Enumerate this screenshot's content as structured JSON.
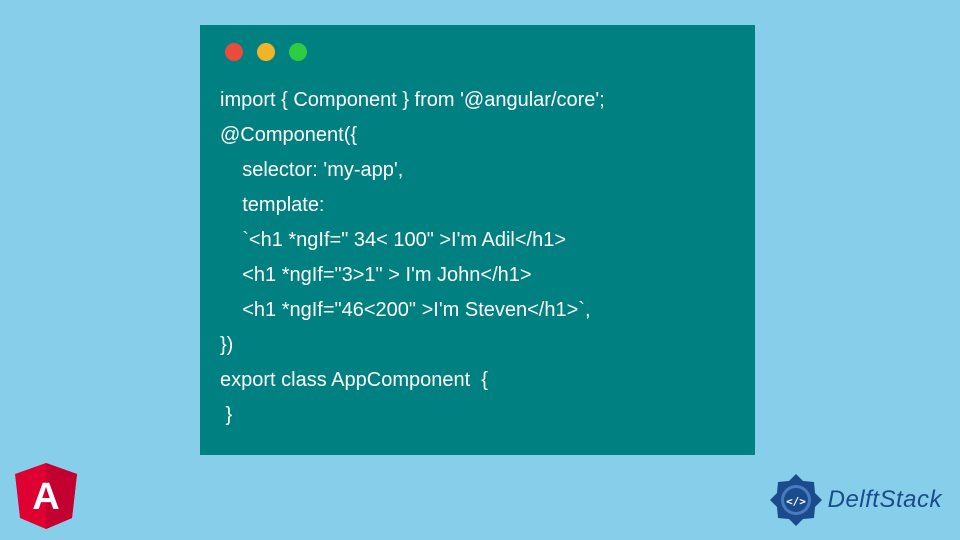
{
  "code": {
    "line1": "import { Component } from '@angular/core';",
    "line2": "@Component({",
    "line3": "    selector: 'my-app',",
    "line4": "    template:",
    "line5": "    `<h1 *ngIf=\" 34< 100\" >I'm Adil</h1>",
    "line6": "    <h1 *ngIf=\"3>1\" > I'm John</h1>",
    "line7": "    <h1 *ngIf=\"46<200\" >I'm Steven</h1>`,",
    "line8": "})",
    "line9": "export class AppComponent  {",
    "line10": " }"
  },
  "logos": {
    "angular_letter": "A",
    "delftstack_label": "DelftStack"
  },
  "colors": {
    "background": "#87ceeb",
    "window": "#008080",
    "dot_red": "#e94b3c",
    "dot_yellow": "#f0b429",
    "dot_green": "#2ecc40"
  }
}
